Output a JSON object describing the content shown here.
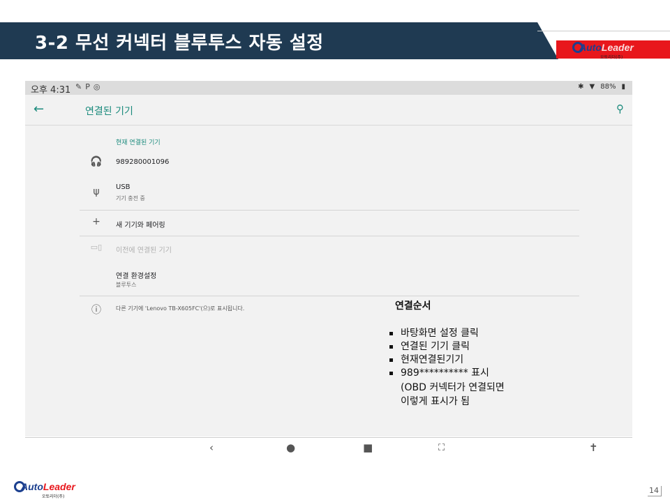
{
  "slide": {
    "title": "3-2 무선 커넥터 블루투스 자동 설정",
    "page_number": "14",
    "logo": {
      "word_a": "Auto",
      "word_b": "Leader",
      "sub": "오토리더(주)"
    }
  },
  "status_bar": {
    "time": "오후 4:31",
    "battery": "88%"
  },
  "app_bar": {
    "title": "연결된 기기"
  },
  "sections": {
    "current_label": "현재 연결된 기기",
    "device1": {
      "title": "989280001096"
    },
    "device2": {
      "title": "USB",
      "subtitle": "기기 충전 중"
    },
    "pair_new": {
      "title": "새 기기와 페어링"
    },
    "previous": {
      "title": "이전에 연결된 기기"
    },
    "prefs": {
      "title": "연결 환경설정",
      "subtitle": "블루투스"
    },
    "info": {
      "text": "다른 기기에 'Lenovo TB-X605FC'(으)로 표시됩니다."
    }
  },
  "icons": {
    "back": "arrow-left-icon",
    "search": "search-icon",
    "headphones": "headphones-icon",
    "usb": "usb-icon",
    "add": "plus-icon",
    "devices": "devices-icon",
    "info": "info-icon"
  },
  "note": {
    "title": "연결순서",
    "steps": [
      "바탕화면 설정 클릭",
      "연결된 기기 클릭",
      "현재연결된기기",
      "989********** 표시"
    ],
    "continuation": [
      "(OBD 커넥터가 연결되면",
      "이렇게 표시가 됨"
    ]
  },
  "colors": {
    "accent": "#1a8a7c",
    "title_bar": "#1f3a52",
    "brand_red": "#e8171c"
  }
}
